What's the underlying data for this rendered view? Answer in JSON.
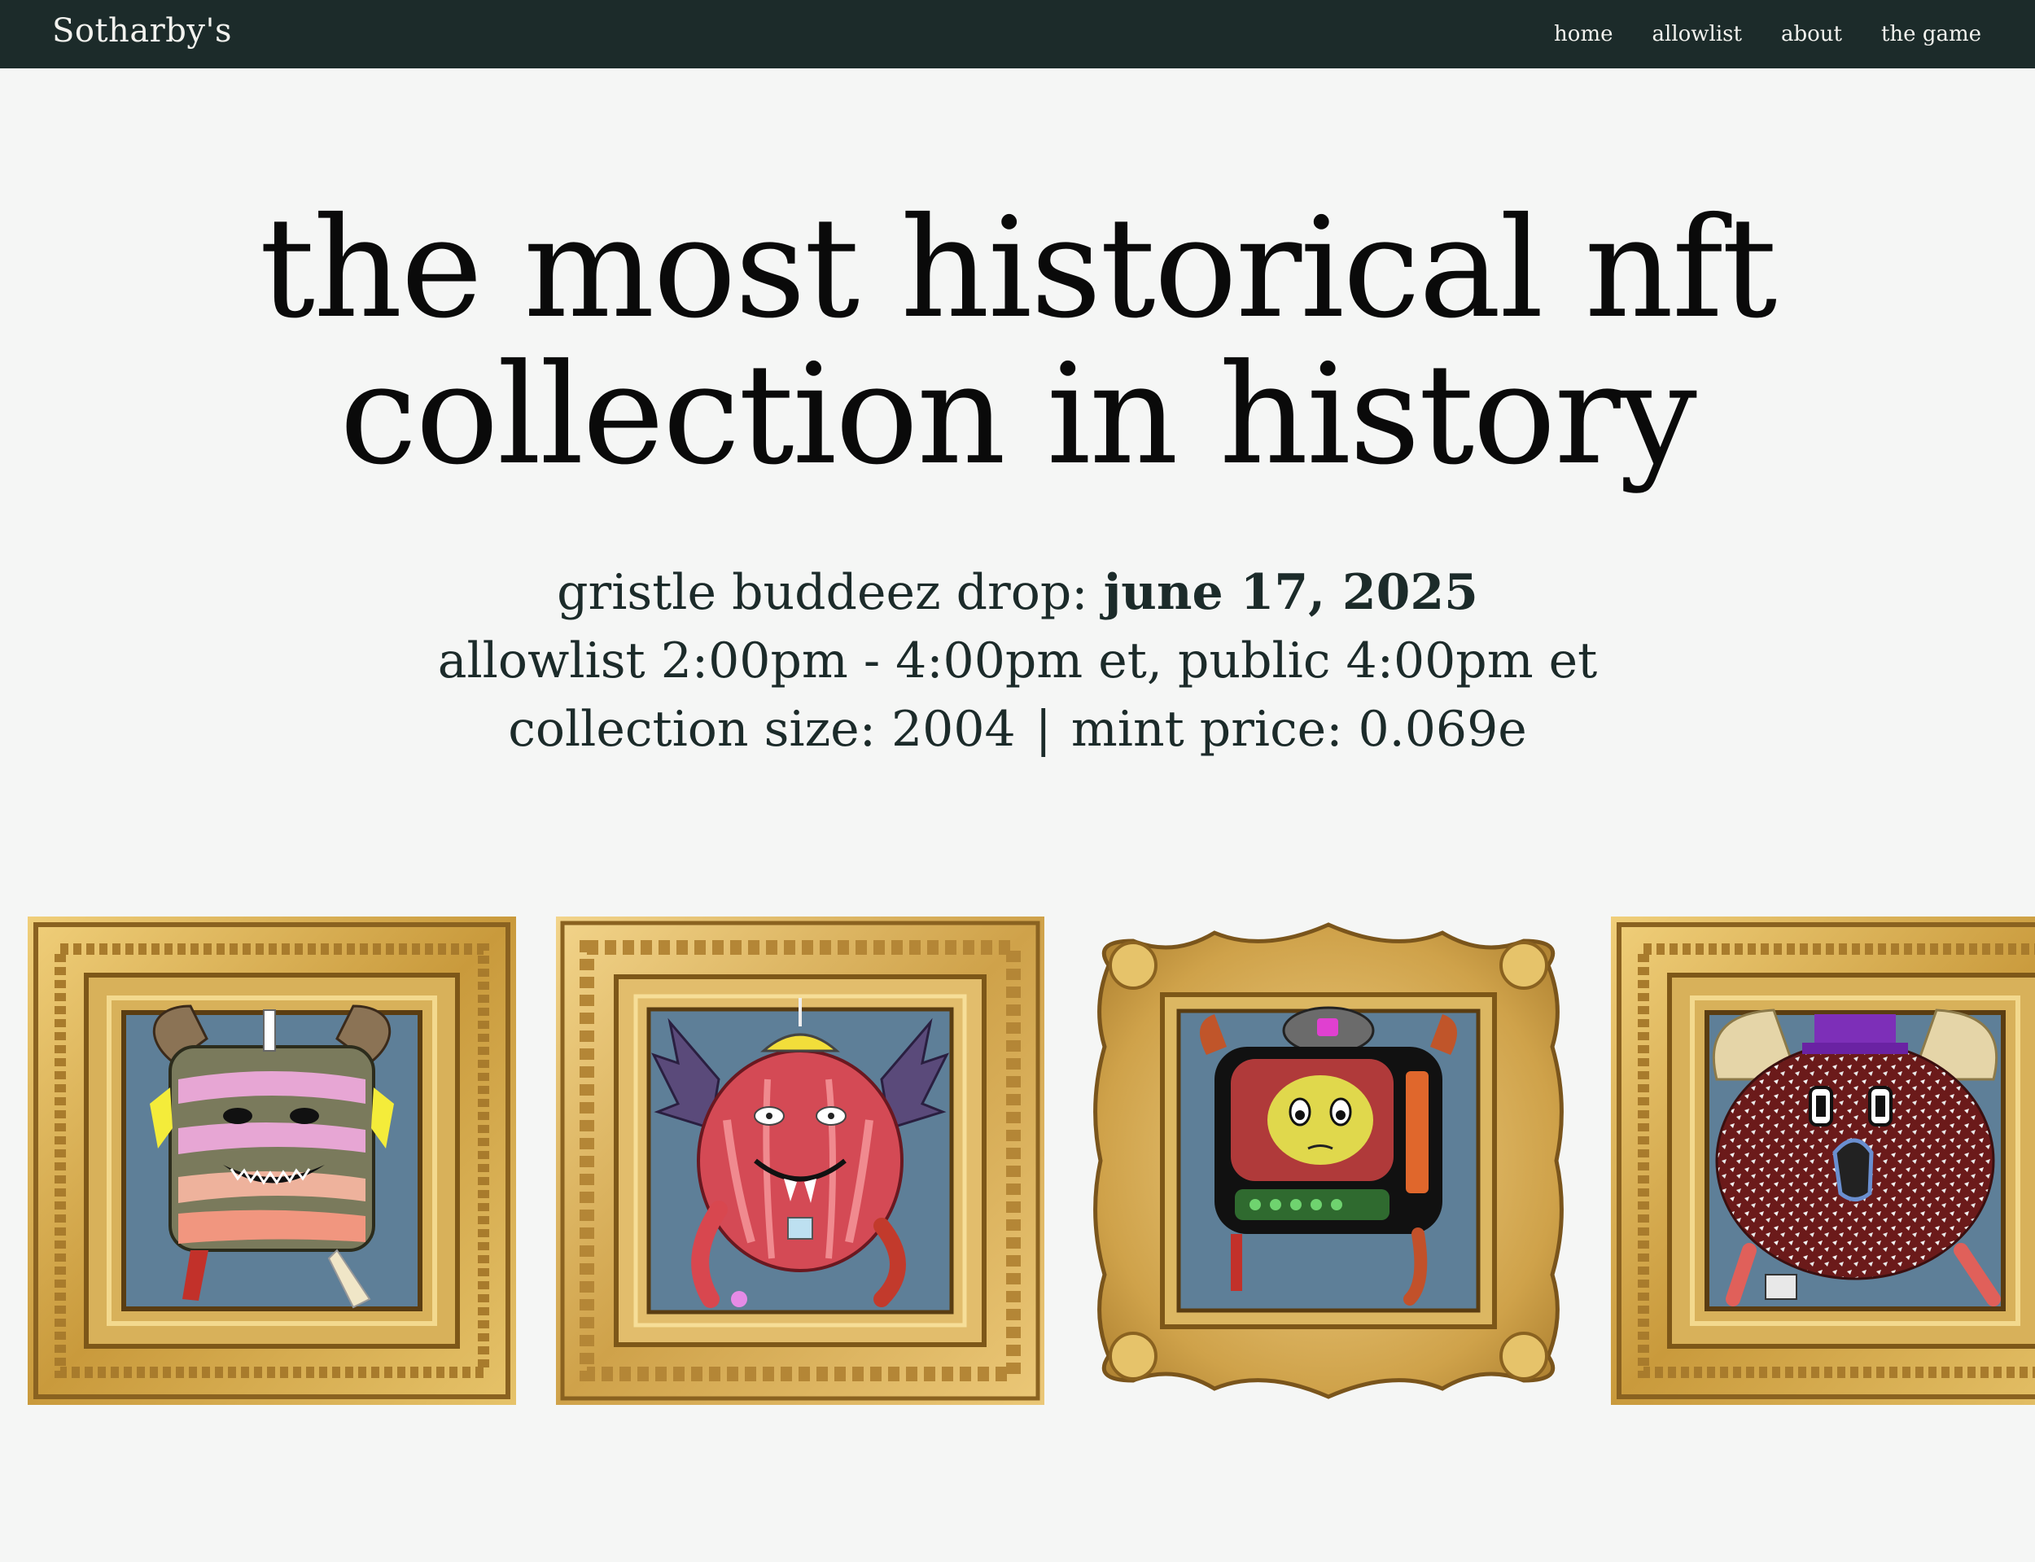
{
  "nav": {
    "brand": "Sotharby's",
    "links": [
      "home",
      "allowlist",
      "about",
      "the game"
    ]
  },
  "hero": {
    "title_line1": "the most historical nft",
    "title_line2": "collection in history",
    "drop_label": "gristle buddeez drop: ",
    "drop_date": "june 17, 2025",
    "schedule": "allowlist 2:00pm - 4:00pm et, public 4:00pm et",
    "collection_size": "collection size: 2004",
    "separator": "|",
    "mint_price": "mint price: 0.069e"
  },
  "gallery": {
    "artworks": [
      {
        "subject": "layered-cake-creature",
        "frame_style": "gold-carved"
      },
      {
        "subject": "red-bat-wing-creature",
        "frame_style": "gold-leaf"
      },
      {
        "subject": "tv-creature",
        "frame_style": "gold-baroque"
      },
      {
        "subject": "fuzzy-purple-hat-creature",
        "frame_style": "gold-carved"
      }
    ],
    "colors": {
      "canvas": "#5e7f98",
      "gold_light": "#e6c36a",
      "gold_mid": "#c99a3c",
      "gold_dark": "#8a6220"
    }
  }
}
